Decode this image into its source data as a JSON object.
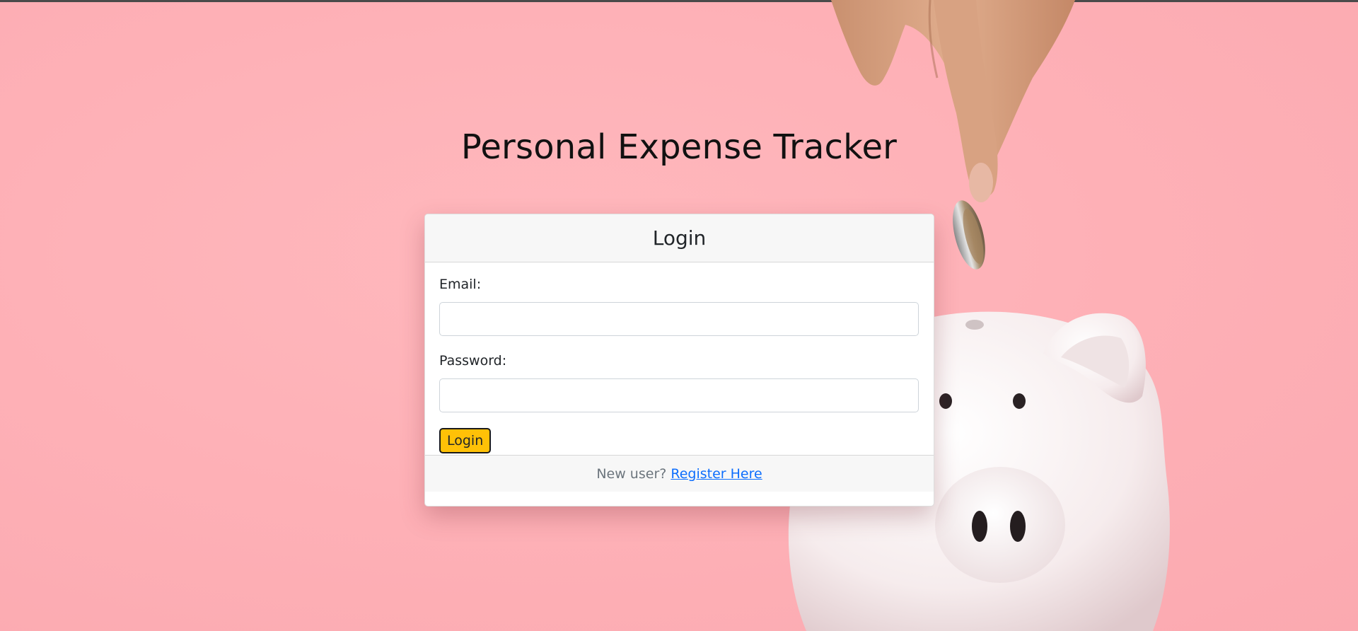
{
  "page": {
    "title": "Personal Expense Tracker"
  },
  "login_card": {
    "header": "Login",
    "email_label": "Email:",
    "email_value": "",
    "password_label": "Password:",
    "password_value": "",
    "submit_label": "Login",
    "footer_text": "New user?",
    "register_link": "Register Here"
  },
  "colors": {
    "background": "#feb1b7",
    "button": "#ffc107",
    "link": "#0d6efd"
  },
  "icons": {
    "background_image": "piggy-bank-coin-illustration"
  }
}
